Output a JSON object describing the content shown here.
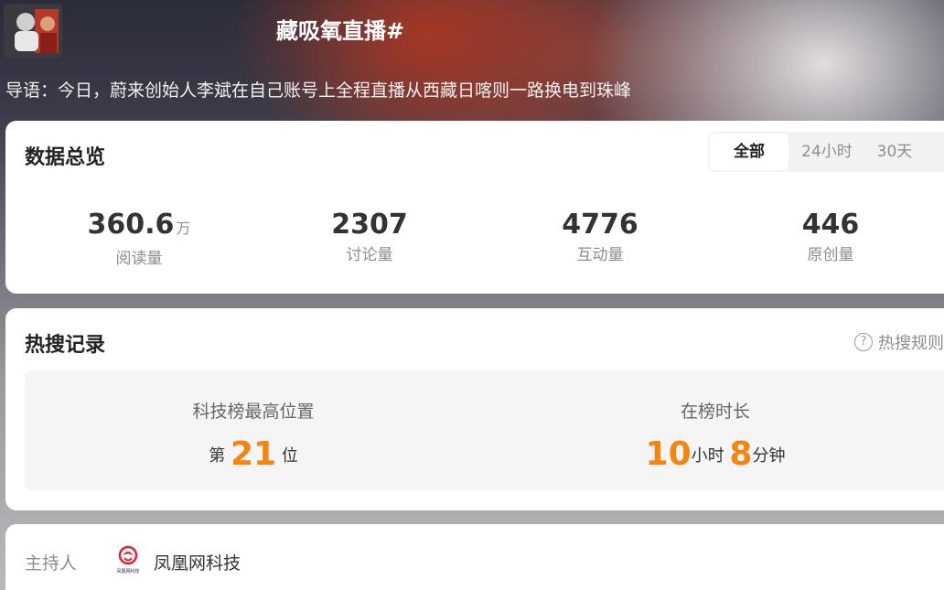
{
  "header": {
    "title": "藏吸氧直播#",
    "intro": "导语：今日，蔚来创始人李斌在自己账号上全程直播从西藏日喀则一路换电到珠峰"
  },
  "overview": {
    "title": "数据总览",
    "tabs": [
      "全部",
      "24小时",
      "30天"
    ],
    "active_tab": "全部",
    "stats": [
      {
        "value": "360.6",
        "unit": "万",
        "label": "阅读量"
      },
      {
        "value": "2307",
        "unit": "",
        "label": "讨论量"
      },
      {
        "value": "4776",
        "unit": "",
        "label": "互动量"
      },
      {
        "value": "446",
        "unit": "",
        "label": "原创量"
      }
    ]
  },
  "hot_search": {
    "title": "热搜记录",
    "rules_link": "热搜规则",
    "rank": {
      "label": "科技榜最高位置",
      "prefix": "第",
      "value": "21",
      "suffix": "位"
    },
    "duration": {
      "label": "在榜时长",
      "hours": "10",
      "hours_unit": "小时",
      "minutes": "8",
      "minutes_unit": "分钟"
    }
  },
  "host": {
    "label": "主持人",
    "name": "凤凰网科技",
    "logo_text": "凤凰网科技"
  },
  "colors": {
    "accent_orange": "#f6840f",
    "card_bg": "#ffffff",
    "muted_text": "#8d8d8d"
  }
}
